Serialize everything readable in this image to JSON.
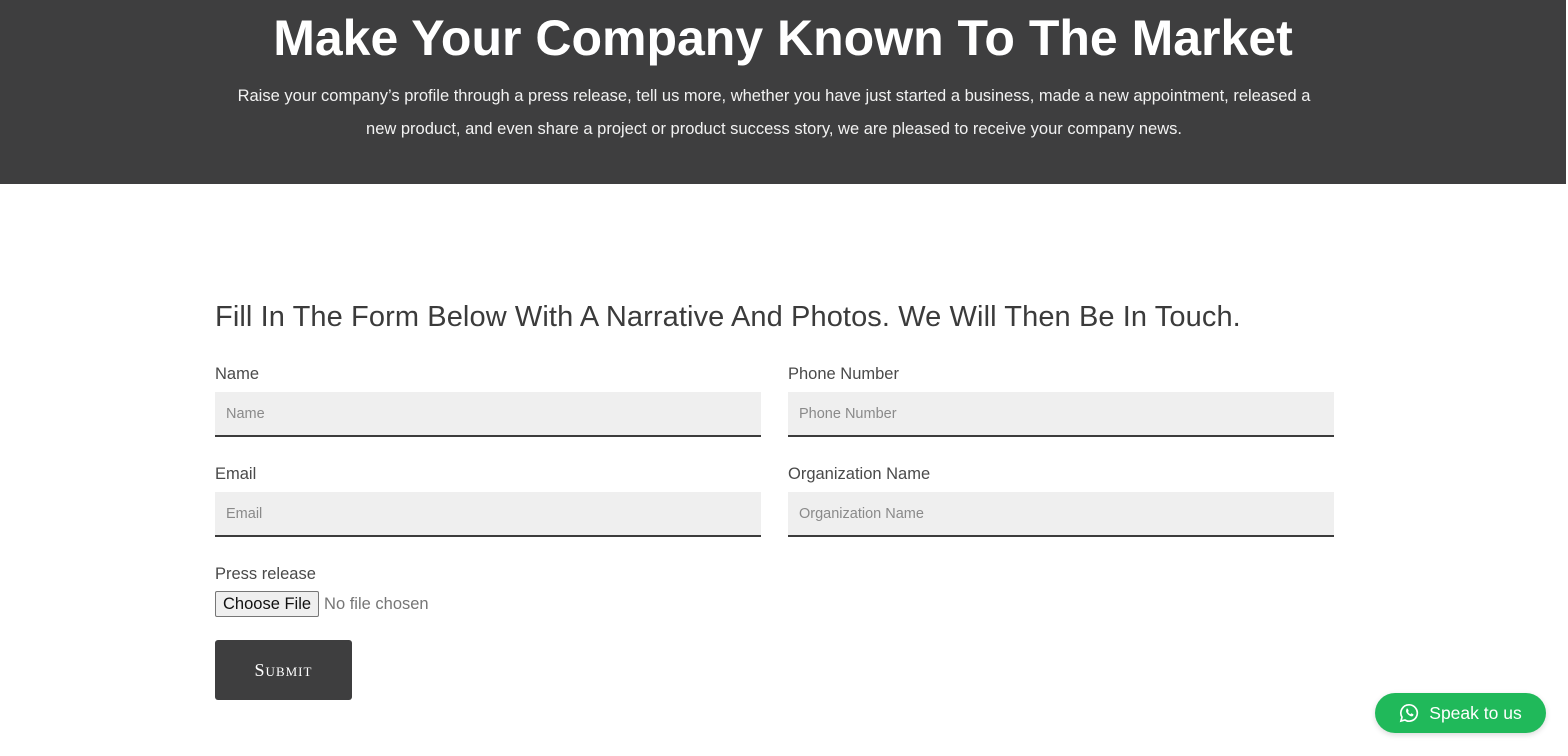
{
  "hero": {
    "title": "Make Your Company Known To The Market",
    "text": "Raise your company’s profile through a press release, tell us more, whether you have just started a business, made a new appointment, released a new product, and even share a project or product success story, we are pleased to receive your company news."
  },
  "form": {
    "heading": "Fill In The Form Below With A Narrative And Photos. We Will Then Be In Touch.",
    "fields": {
      "name": {
        "label": "Name",
        "placeholder": "Name",
        "value": ""
      },
      "phone": {
        "label": "Phone Number",
        "placeholder": "Phone Number",
        "value": ""
      },
      "email": {
        "label": "Email",
        "placeholder": "Email",
        "value": ""
      },
      "organization": {
        "label": "Organization Name",
        "placeholder": "Organization Name",
        "value": ""
      }
    },
    "file": {
      "label": "Press release",
      "button_label": "Choose File",
      "status": "No file chosen"
    },
    "submit_label": "Submit"
  },
  "chat": {
    "label": "Speak to us",
    "icon": "whatsapp-icon",
    "color": "#20b95a"
  },
  "colors": {
    "hero_background": "#3e3e3f",
    "input_background": "#efefef"
  }
}
